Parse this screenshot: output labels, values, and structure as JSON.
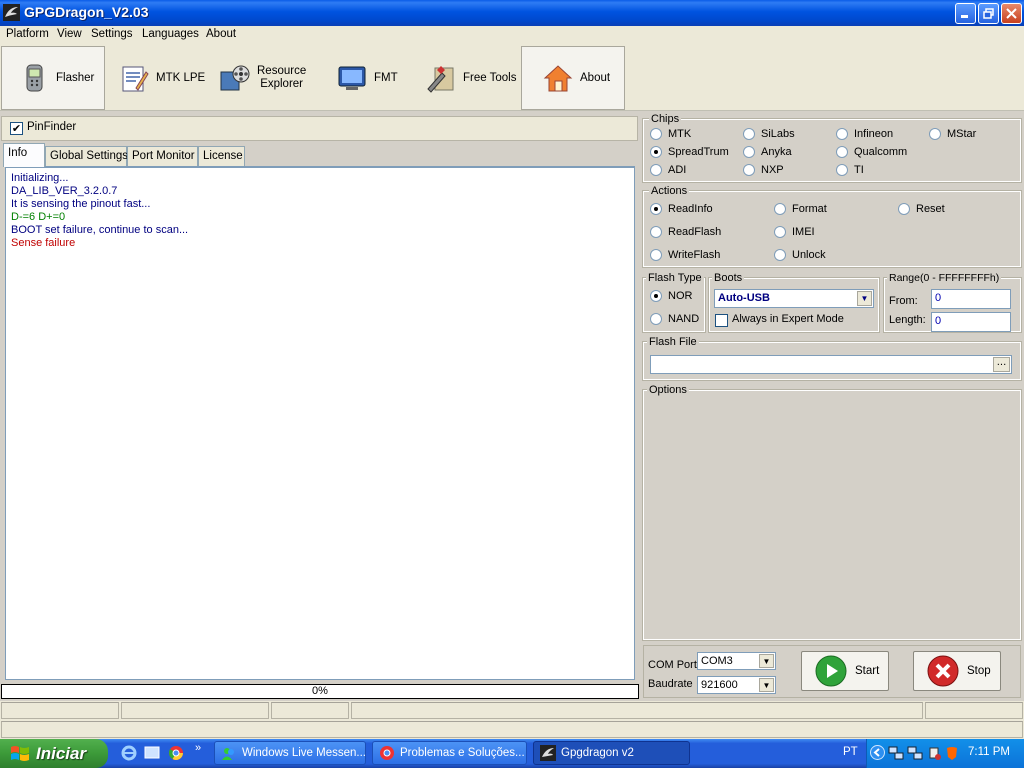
{
  "window": {
    "title": "GPGDragon_V2.03"
  },
  "menu": [
    "Platform",
    "View",
    "Settings",
    "Languages",
    "About"
  ],
  "toolbar": {
    "flasher": "Flasher",
    "mtk_lpe": "MTK LPE",
    "resource_1": "Resource",
    "resource_2": "Explorer",
    "fmt": "FMT",
    "free_tools": "Free Tools",
    "about": "About"
  },
  "pinfinder": {
    "label": "PinFinder",
    "checked": true
  },
  "tabs": [
    "Info",
    "Global Settings",
    "Port Monitor",
    "License"
  ],
  "log": [
    {
      "text": "Initializing...",
      "color": "#000080"
    },
    {
      "text": "DA_LIB_VER_3.2.0.7",
      "color": "#000080"
    },
    {
      "text": "It is sensing the pinout fast...",
      "color": "#000080"
    },
    {
      "text": "D-=6  D+=0",
      "color": "#008000"
    },
    {
      "text": "BOOT set failure, continue to scan...",
      "color": "#000080"
    },
    {
      "text": "Sense failure",
      "color": "#c00000"
    }
  ],
  "progress": {
    "value": 0,
    "label": "0%"
  },
  "chips": {
    "title": "Chips",
    "mtk": "MTK",
    "silabs": "SiLabs",
    "infineon": "Infineon",
    "mstar": "MStar",
    "spreadtrum": "SpreadTrum",
    "anyka": "Anyka",
    "qualcomm": "Qualcomm",
    "adi": "ADI",
    "nxp": "NXP",
    "ti": "TI",
    "selected": "SpreadTrum"
  },
  "actions": {
    "title": "Actions",
    "readinfo": "ReadInfo",
    "format": "Format",
    "reset": "Reset",
    "readflash": "ReadFlash",
    "imei": "IMEI",
    "writeflash": "WriteFlash",
    "unlock": "Unlock",
    "selected": "ReadInfo"
  },
  "flash_type": {
    "title": "Flash Type",
    "nor": "NOR",
    "nand": "NAND",
    "selected": "NOR"
  },
  "boots": {
    "title": "Boots",
    "value": "Auto-USB",
    "expert_label": "Always in Expert Mode",
    "expert_checked": false
  },
  "range": {
    "title": "Range(0 - FFFFFFFFh)",
    "from_label": "From:",
    "from_value": "0",
    "length_label": "Length:",
    "length_value": "0"
  },
  "flash_file": {
    "title": "Flash File",
    "value": "",
    "browse": "..."
  },
  "options": {
    "title": "Options"
  },
  "port": {
    "com_label": "COM Port",
    "com_value": "COM3",
    "baud_label": "Baudrate",
    "baud_value": "921600"
  },
  "buttons": {
    "start": "Start",
    "stop": "Stop"
  },
  "taskbar": {
    "start": "Iniciar",
    "tasks": [
      "Windows Live Messen...",
      "Problemas e Soluções...",
      "Gpgdragon v2"
    ],
    "lang": "PT",
    "clock": "7:11 PM"
  }
}
